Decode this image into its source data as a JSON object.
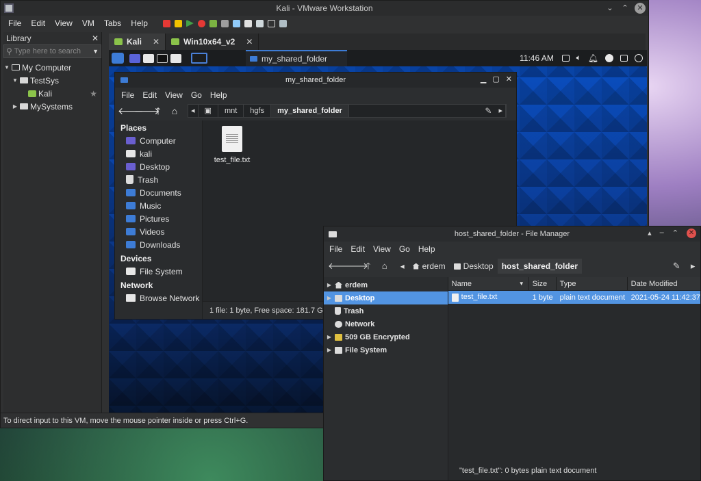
{
  "vmware": {
    "title": "Kali - VMware Workstation",
    "menu": [
      "File",
      "Edit",
      "View",
      "VM",
      "Tabs",
      "Help"
    ],
    "library": {
      "title": "Library",
      "search_placeholder": "Type here to search",
      "tree": {
        "my_computer": "My Computer",
        "testsys": "TestSys",
        "kali": "Kali",
        "mysystems": "MySystems"
      }
    },
    "tabs": [
      {
        "label": "Kali"
      },
      {
        "label": "Win10x64_v2"
      }
    ],
    "status": "To direct input to this VM, move the mouse pointer inside or press Ctrl+G."
  },
  "kali_panel": {
    "task_label": "my_shared_folder",
    "clock": "11:46 AM"
  },
  "guest_fm": {
    "title": "my_shared_folder",
    "menu": [
      "File",
      "Edit",
      "View",
      "Go",
      "Help"
    ],
    "path": [
      "mnt",
      "hgfs",
      "my_shared_folder"
    ],
    "places_heading": "Places",
    "places": [
      "Computer",
      "kali",
      "Desktop",
      "Trash",
      "Documents",
      "Music",
      "Pictures",
      "Videos",
      "Downloads"
    ],
    "devices_heading": "Devices",
    "devices": [
      "File System"
    ],
    "network_heading": "Network",
    "network": [
      "Browse Network"
    ],
    "files": [
      {
        "name": "test_file.txt"
      }
    ],
    "status": "1 file: 1 byte, Free space: 181.7 GiB"
  },
  "host_fm": {
    "title": "host_shared_folder - File Manager",
    "menu": [
      "File",
      "Edit",
      "View",
      "Go",
      "Help"
    ],
    "path": [
      "erdem",
      "Desktop",
      "host_shared_folder"
    ],
    "sidebar": [
      "erdem",
      "Desktop",
      "Trash",
      "Network",
      "509 GB Encrypted",
      "File System"
    ],
    "columns": [
      "Name",
      "Size",
      "Type",
      "Date Modified"
    ],
    "rows": [
      {
        "name": "test_file.txt",
        "size": "1 byte",
        "type": "plain text document",
        "modified": "2021-05-24 11:42:37"
      }
    ],
    "status": "\"test_file.txt\": 0 bytes plain text document"
  }
}
